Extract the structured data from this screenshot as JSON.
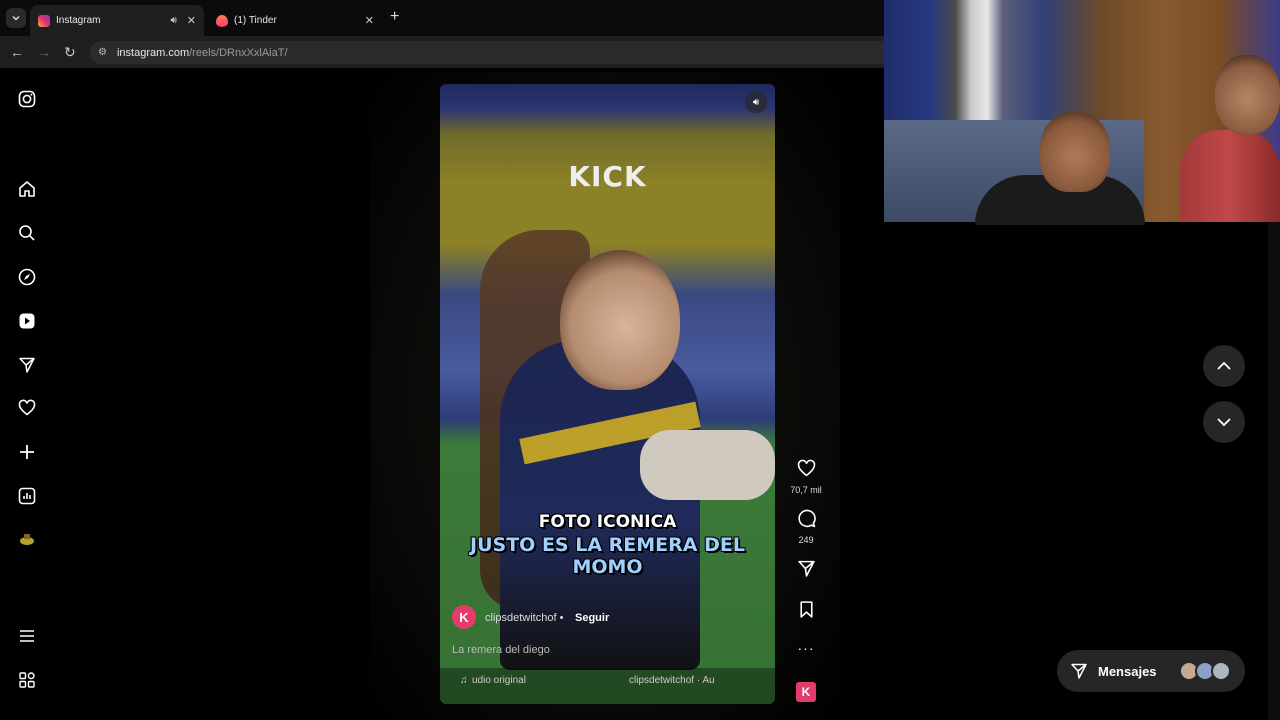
{
  "browser": {
    "tabs": [
      {
        "title": "Instagram",
        "active": true
      },
      {
        "title": "(1) Tinder",
        "active": false
      }
    ],
    "url": {
      "host": "instagram.com",
      "path": "/reels/DRnxXxlAiaT/"
    }
  },
  "sidebar": {
    "items": [
      "instagram-logo",
      "home",
      "search",
      "explore",
      "reels",
      "messages",
      "notifications",
      "create",
      "dashboard",
      "profile",
      "more",
      "also-from-meta"
    ]
  },
  "reel": {
    "overlay_logo": "KICK",
    "caption_line1": "FOTO ICONICA",
    "caption_line2": "JUSTO ES LA REMERA DEL MOMO",
    "author": "clipsdetwitchof",
    "separator": "•",
    "follow_label": "Seguir",
    "description": "La remera del diego",
    "audio_label": "udio original",
    "audio_author": "clipsdetwitchof · Au",
    "avatar_letter": "K"
  },
  "actions": {
    "likes": "70,7 mil",
    "comments": "249"
  },
  "messages_pill": {
    "label": "Mensajes"
  },
  "colors": {
    "accent": "#e33b6b",
    "chrome_bg": "#1f1f1f",
    "pill_bg": "#262626"
  }
}
